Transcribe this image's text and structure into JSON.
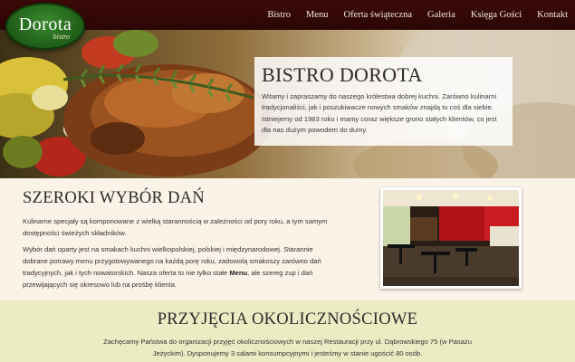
{
  "header": {
    "logo_name": "Dorota",
    "logo_sub": "bistro",
    "nav": [
      {
        "label": "Bistro"
      },
      {
        "label": "Menu"
      },
      {
        "label": "Oferta świąteczna"
      },
      {
        "label": "Galeria"
      },
      {
        "label": "Księga Gości"
      },
      {
        "label": "Kontakt"
      }
    ]
  },
  "hero": {
    "title": "BISTRO DOROTA",
    "text": "Witamy i zapraszamy do naszego królestwa dobrej kuchni. Zarówno kulinarni tradycjonaliści, jak i poszukiwacze nowych smaków znajdą tu coś dla siebie. Istniejemy od 1983 roku i mamy coraz większe grono stałych klientów, co jest dla nas dużym powodem do dumy."
  },
  "section1": {
    "title": "SZEROKI WYBÓR DAŃ",
    "p1": "Kulinarne specjały są komponowane z wielką starannością w zależności od pory roku, a tym samym dostępności świeżych składników.",
    "p2_before": "Wybór dań oparty jest na smakach kuchni wielkopolskiej, polskiej i międzynarodowej. Starannie dobrane potrawy menu przygotowywanego na każdą porę roku, zadowolą smakoszy zarówno dań tradycyjnych, jak i tych nowatorskich. Nasza oferta to nie tylko stałe ",
    "p2_bold": "Menu",
    "p2_after": ", ale szereg zup i dań przewijających się okresowo lub na prośbę klienta."
  },
  "section2": {
    "title": "PRZYJĘCIA OKOLICZNOŚCIOWE",
    "text": "Zachęcamy Państwa do organizacji przyjęć okolicznościowych w naszej Restauracji przy ul. Dąbrowskiego 75 (w Pasażu Jeżyckim). Dysponujemy 3 salami konsumpcyjnymi i jesteśmy w stanie ugościć 80 osób."
  },
  "colors": {
    "header_bg": "#3c0a08",
    "logo_green": "#2e7a25",
    "section1_bg": "#fbf2e8",
    "section2_bg": "#ececc4"
  }
}
